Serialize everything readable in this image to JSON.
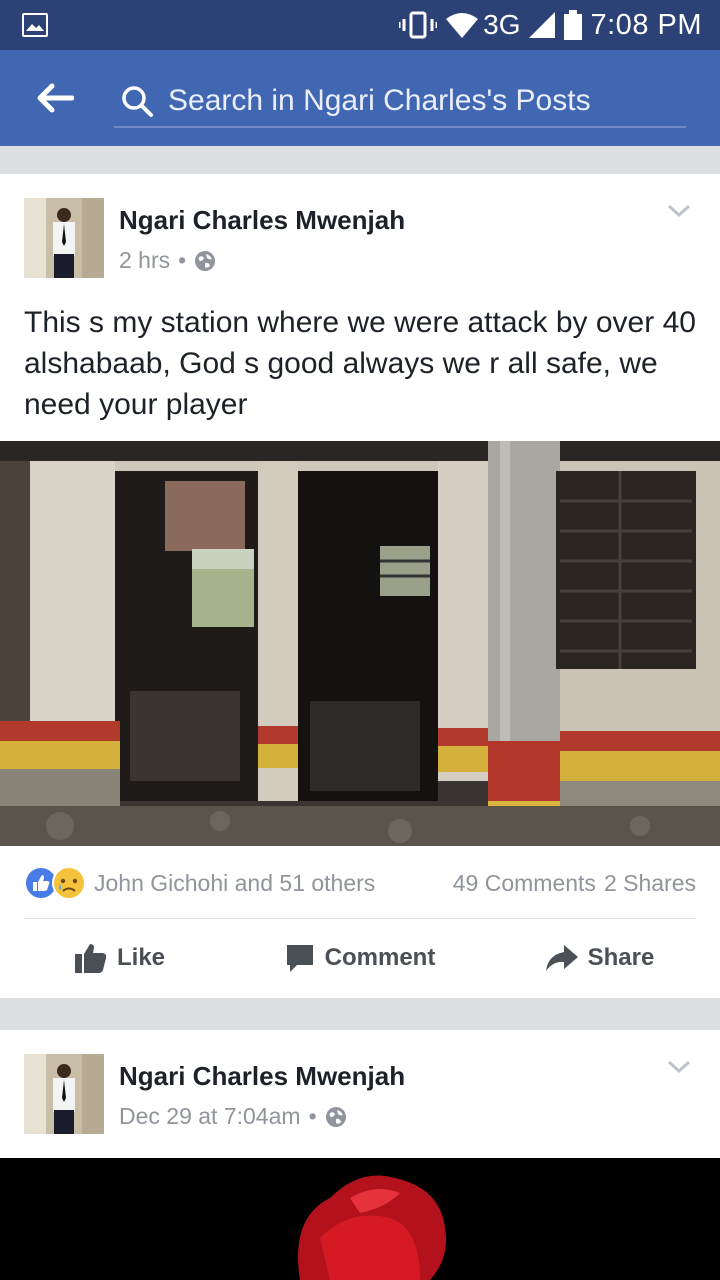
{
  "status_bar": {
    "network": "3G",
    "time": "7:08 PM",
    "icons": [
      "gallery-icon",
      "vibrate-icon",
      "wifi-icon",
      "signal-icon",
      "battery-icon"
    ]
  },
  "header": {
    "search_placeholder": "Search in Ngari Charles's Posts",
    "icons": [
      "back-arrow-icon",
      "search-icon"
    ]
  },
  "posts": [
    {
      "author": "Ngari Charles Mwenjah",
      "time": "2 hrs",
      "separator": "•",
      "privacy_icon": "globe-icon",
      "text": "This s my station where  we were attack by over 40 alshabaab, God s good always we r all safe, we need your  player",
      "reactions": {
        "types": [
          "like",
          "sad"
        ],
        "names": "John Gichohi and 51 others",
        "comments": "49 Comments",
        "shares": "2 Shares"
      },
      "actions": {
        "like": "Like",
        "comment": "Comment",
        "share": "Share"
      }
    },
    {
      "author": "Ngari Charles Mwenjah",
      "time": "Dec 29 at 7:04am",
      "separator": "•",
      "privacy_icon": "globe-icon"
    }
  ],
  "colors": {
    "status_bar": "#2c4176",
    "header": "#4267b2",
    "feed_bg": "#dddfe2",
    "link_blue": "#4267b2"
  }
}
